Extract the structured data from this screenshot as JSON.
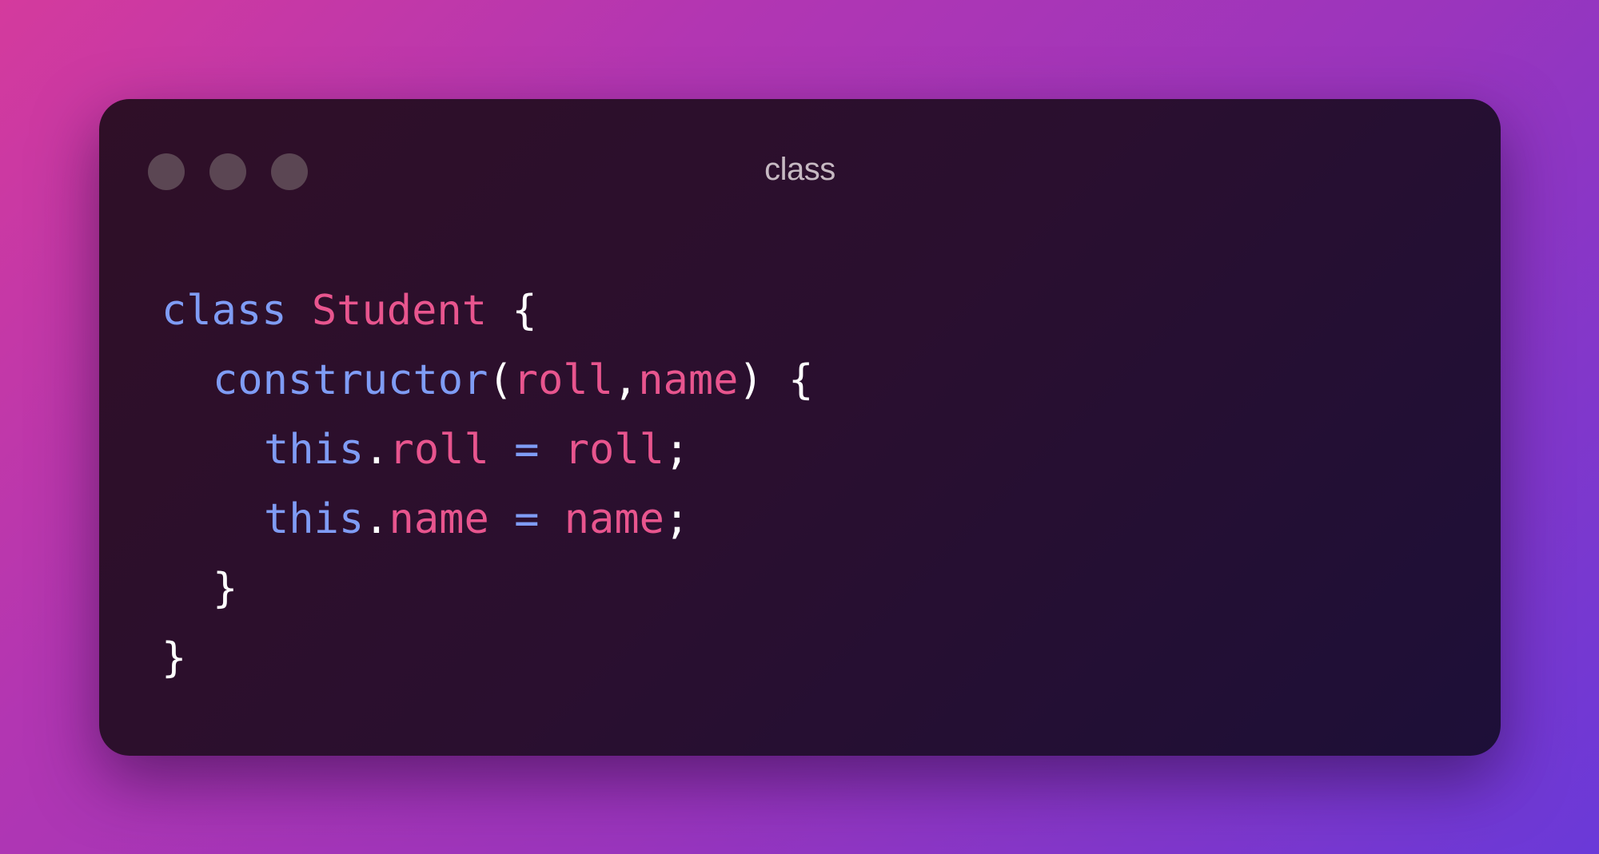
{
  "window": {
    "title": "class",
    "control_dot_color": "#5b4653",
    "title_color": "#c6b9c2"
  },
  "code": {
    "colors": {
      "keyword": "#7f9cf5",
      "identifier": "#e8558e",
      "punctuation": "#ffffff"
    },
    "lines": [
      {
        "keyword": "class",
        "space": " ",
        "name": "Student",
        "rest": " {"
      },
      {
        "method": "constructor",
        "open": "(",
        "p1": "roll",
        "comma": ",",
        "p2": "name",
        "close": ") {"
      },
      {
        "self": "this",
        "dot": ".",
        "prop": "roll",
        "eq": " = ",
        "val": "roll",
        "semi": ";"
      },
      {
        "self": "this",
        "dot": ".",
        "prop": "name",
        "eq": " = ",
        "val": "name",
        "semi": ";"
      },
      {
        "brace": "}"
      },
      {
        "brace": "}"
      }
    ]
  }
}
